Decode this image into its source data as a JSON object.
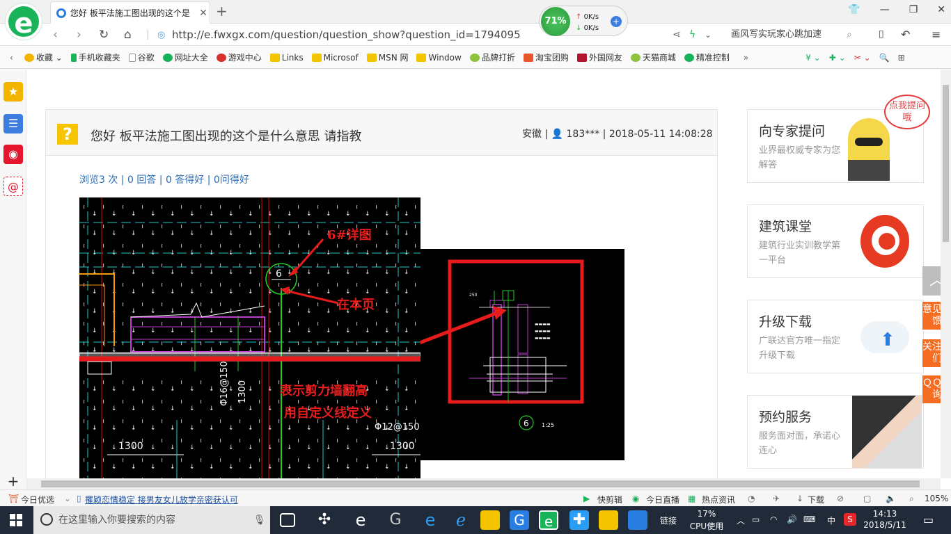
{
  "browser": {
    "tab_title": "您好 板平法施工图出现的这个是",
    "url": "http://e.fwxgx.com/question/question_show?question_id=1794095",
    "search_text": "画风写实玩家心跳加速",
    "net_percent": "71%",
    "net_up": "0K/s",
    "net_down": "0K/s"
  },
  "favorites": [
    {
      "label": "收藏",
      "color": "#f3b400"
    },
    {
      "label": "手机收藏夹",
      "color": "#19b35a"
    },
    {
      "label": "谷歌",
      "color": "#888888"
    },
    {
      "label": "网址大全",
      "color": "#19b35a"
    },
    {
      "label": "游戏中心",
      "color": "#d8312b"
    },
    {
      "label": "Links",
      "color": "#f3c500"
    },
    {
      "label": "Microsof",
      "color": "#f3c500"
    },
    {
      "label": "MSN 网",
      "color": "#f3c500"
    },
    {
      "label": "Window",
      "color": "#f3c500"
    },
    {
      "label": "品牌打折",
      "color": "#8ec43c"
    },
    {
      "label": "淘宝团购",
      "color": "#e8572b"
    },
    {
      "label": "外国网友",
      "color": "#b3142e"
    },
    {
      "label": "天猫商城",
      "color": "#8ec43c"
    },
    {
      "label": "精准控制",
      "color": "#19b35a"
    }
  ],
  "question": {
    "title": "您好 板平法施工图出现的这个是什么意思 请指教",
    "meta": "安徽 | 👤 183*** | 2018-05-11 14:08:28",
    "stats": "浏览3 次 | 0 回答 | 0 答得好 | 0问得好"
  },
  "cad": {
    "label_detail": "6#详图",
    "label_page": "在本页",
    "label_wall1": "表示剪力墙翻高",
    "label_wall2": "用自定义线定义",
    "dim1": "Φ16@150",
    "dim2": "1300",
    "dim3": "Φ12@150",
    "dim4": "1300",
    "dim5": "1300",
    "circle_num": "6",
    "scale": "1:25"
  },
  "cards": [
    {
      "title": "向专家提问",
      "sub": "业界最权威专家为您解答",
      "bubble": "点我提问哦"
    },
    {
      "title": "建筑课堂",
      "sub": "建筑行业实训教学第一平台"
    },
    {
      "title": "升级下载",
      "sub": "广联达官方唯一指定升级下载"
    },
    {
      "title": "预约服务",
      "sub": "服务面对面，承诺心连心"
    }
  ],
  "float_buttons": {
    "feedback": "意见反馈",
    "follow": "关注我们",
    "qq": "ＱＱ咨询"
  },
  "statusbar": {
    "today": "今日优选",
    "news": "罹颖恋情稳定 接男友女儿放学亲密获认可",
    "kuaijian": "快剪辑",
    "live": "今日直播",
    "hot": "热点资讯",
    "download": "下载",
    "zoom": "105%"
  },
  "taskbar": {
    "search_placeholder": "在这里输入你要搜索的内容",
    "link_label": "链接",
    "cpu_percent": "17%",
    "cpu_label": "CPU使用",
    "ime": "中",
    "time": "14:13",
    "date": "2018/5/11"
  }
}
